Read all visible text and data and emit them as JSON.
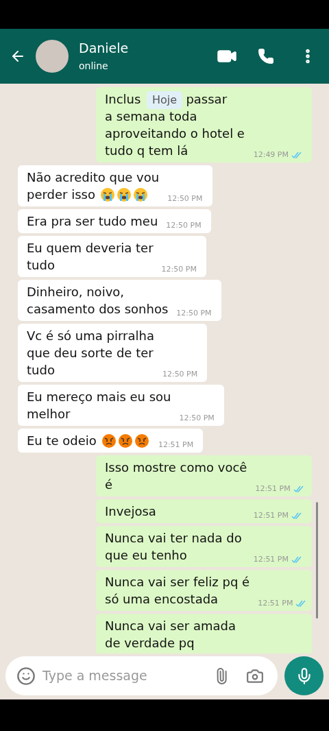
{
  "header": {
    "name": "Daniele",
    "status": "online"
  },
  "date_chip": "Hoje",
  "messages": [
    {
      "kind": "outgoing",
      "lines": [
        [
          "Inclus",
          "passar"
        ],
        "a semana toda",
        "aproveitando o hotel e",
        "tudo q tem lá"
      ],
      "time": "12:49 PM",
      "read": true
    },
    {
      "kind": "incoming",
      "lines": [
        "Não acredito que vou",
        "perder isso"
      ],
      "emojis": [
        {
          "kind": "crying"
        },
        {
          "kind": "crying"
        },
        {
          "kind": "crying"
        }
      ],
      "time": "12:50 PM"
    },
    {
      "kind": "incoming",
      "lines": [
        "Era pra ser tudo meu"
      ],
      "time": "12:50 PM"
    },
    {
      "kind": "incoming",
      "lines": [
        "Eu quem deveria ter",
        "tudo"
      ],
      "time": "12:50 PM"
    },
    {
      "kind": "incoming",
      "lines": [
        "Dinheiro, noivo,",
        "casamento dos sonhos"
      ],
      "time": "12:50 PM"
    },
    {
      "kind": "incoming",
      "lines": [
        "Vc é só uma pirralha",
        "que deu sorte de ter",
        "tudo"
      ],
      "time": "12:50 PM"
    },
    {
      "kind": "incoming",
      "lines": [
        "Eu mereço mais eu sou",
        "melhor"
      ],
      "time": "12:50 PM"
    },
    {
      "kind": "incoming",
      "lines": [
        "Eu te odeio"
      ],
      "emojis": [
        {
          "kind": "angry"
        },
        {
          "kind": "angry"
        },
        {
          "kind": "angry"
        }
      ],
      "time": "12:51 PM"
    },
    {
      "kind": "outgoing",
      "lines": [
        "Isso mostre como você",
        "é"
      ],
      "time": "12:51 PM",
      "read": true
    },
    {
      "kind": "outgoing",
      "lines": [
        "Invejosa"
      ],
      "time": "12:51 PM",
      "read": true
    },
    {
      "kind": "outgoing",
      "lines": [
        "Nunca vai ter nada do",
        "que eu tenho"
      ],
      "time": "12:51 PM",
      "read": true
    },
    {
      "kind": "outgoing",
      "lines": [
        "Nunca vai ser feliz pq é",
        "só uma encostada"
      ],
      "time": "12:51 PM",
      "read": true
    },
    {
      "kind": "outgoing",
      "lines": [
        "Nunca vai ser amada",
        "de verdade pq"
      ]
    }
  ],
  "composer": {
    "placeholder": "Type a message"
  }
}
